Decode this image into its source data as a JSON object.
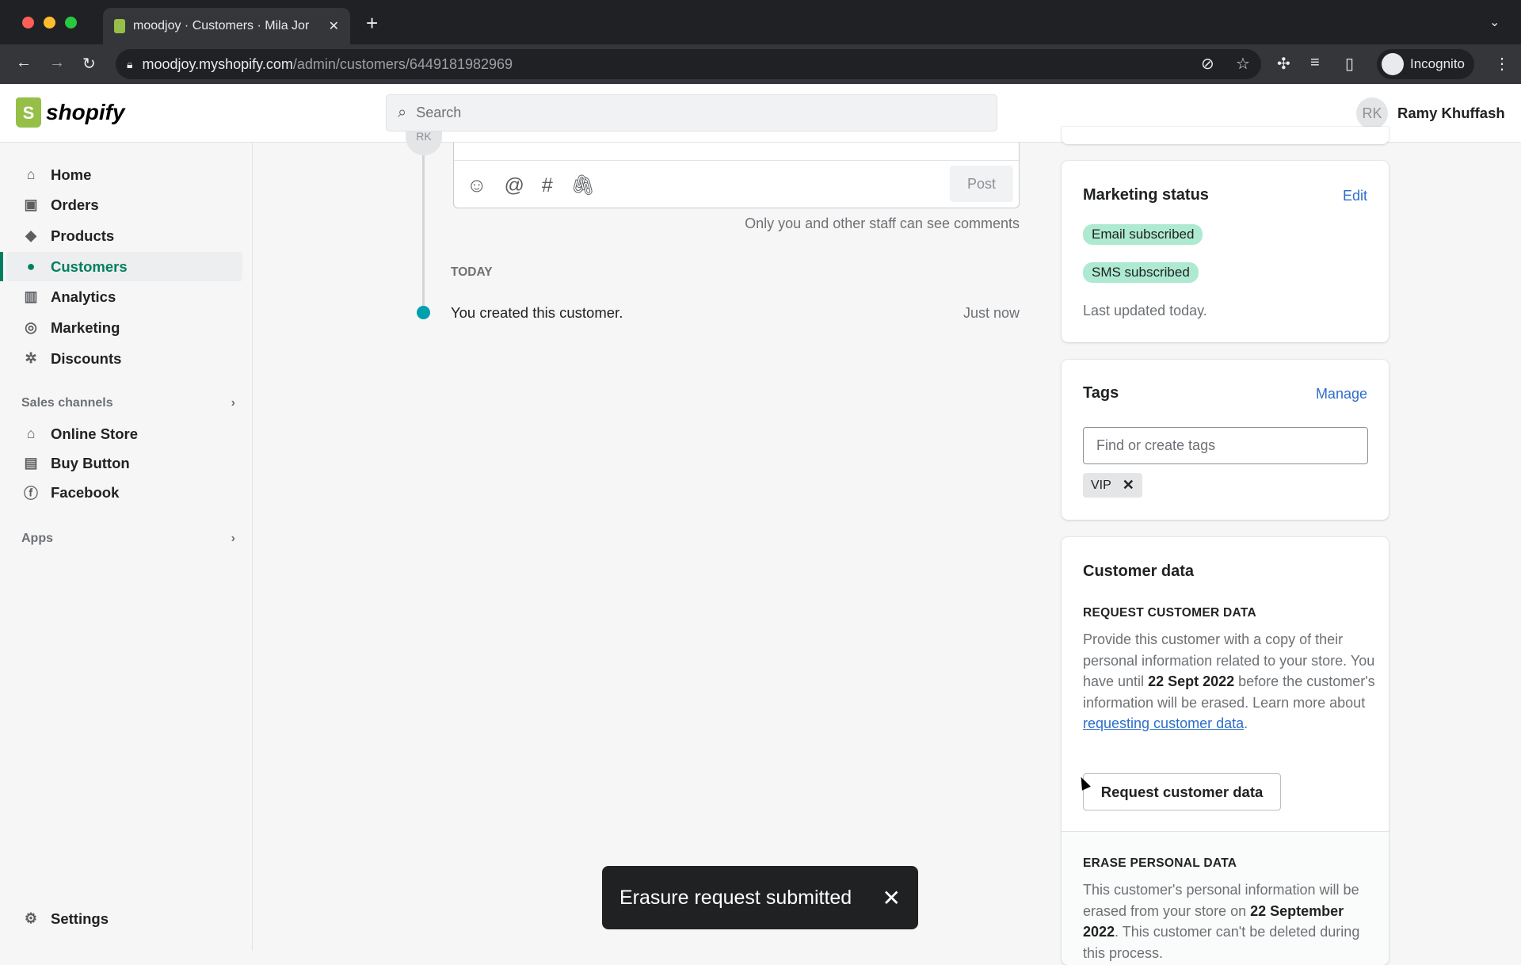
{
  "browser": {
    "tab_title": "moodjoy · Customers · Mila Jor",
    "url_host": "moodjoy.myshopify.com",
    "url_path": "/admin/customers/6449181982969",
    "profile": "Incognito"
  },
  "header": {
    "logo": "shopify",
    "search_placeholder": "Search",
    "user_initials": "RK",
    "user_name": "Ramy Khuffash"
  },
  "sidebar": {
    "items": [
      {
        "label": "Home",
        "icon": "home-icon"
      },
      {
        "label": "Orders",
        "icon": "orders-icon"
      },
      {
        "label": "Products",
        "icon": "tag-icon"
      },
      {
        "label": "Customers",
        "icon": "person-icon"
      },
      {
        "label": "Analytics",
        "icon": "bar-chart-icon"
      },
      {
        "label": "Marketing",
        "icon": "target-icon"
      },
      {
        "label": "Discounts",
        "icon": "discount-icon"
      }
    ],
    "sales_channels_label": "Sales channels",
    "channels": [
      {
        "label": "Online Store"
      },
      {
        "label": "Buy Button"
      },
      {
        "label": "Facebook"
      }
    ],
    "apps_label": "Apps",
    "settings_label": "Settings"
  },
  "timeline": {
    "post_label": "Post",
    "comment_note": "Only you and other staff can see comments",
    "day_label": "TODAY",
    "event_text": "You created this customer.",
    "event_time": "Just now",
    "avatar_initials": "RK"
  },
  "marketing": {
    "title": "Marketing status",
    "edit": "Edit",
    "badges": [
      "Email subscribed",
      "SMS subscribed"
    ],
    "updated": "Last updated today."
  },
  "tags": {
    "title": "Tags",
    "manage": "Manage",
    "placeholder": "Find or create tags",
    "items": [
      "VIP"
    ]
  },
  "customer_data": {
    "title": "Customer data",
    "request_heading": "REQUEST CUSTOMER DATA",
    "request_p1": "Provide this customer with a copy of their personal information related to your store. You have until ",
    "request_date": "22 Sept 2022",
    "request_p2": " before the customer's information will be erased. Learn more about ",
    "request_link": "requesting customer data",
    "request_p3": ".",
    "request_button": "Request customer data",
    "erase_heading": "ERASE PERSONAL DATA",
    "erase_p1": "This customer's personal information will be erased from your store on ",
    "erase_date": "22 September 2022",
    "erase_p2": ". This customer can't be deleted during this process."
  },
  "toast": {
    "message": "Erasure request submitted"
  },
  "colors": {
    "accent": "#007f5f",
    "link": "#2c6ecb",
    "badge": "#aee9d1",
    "timeline_dot": "#00a0ac"
  }
}
